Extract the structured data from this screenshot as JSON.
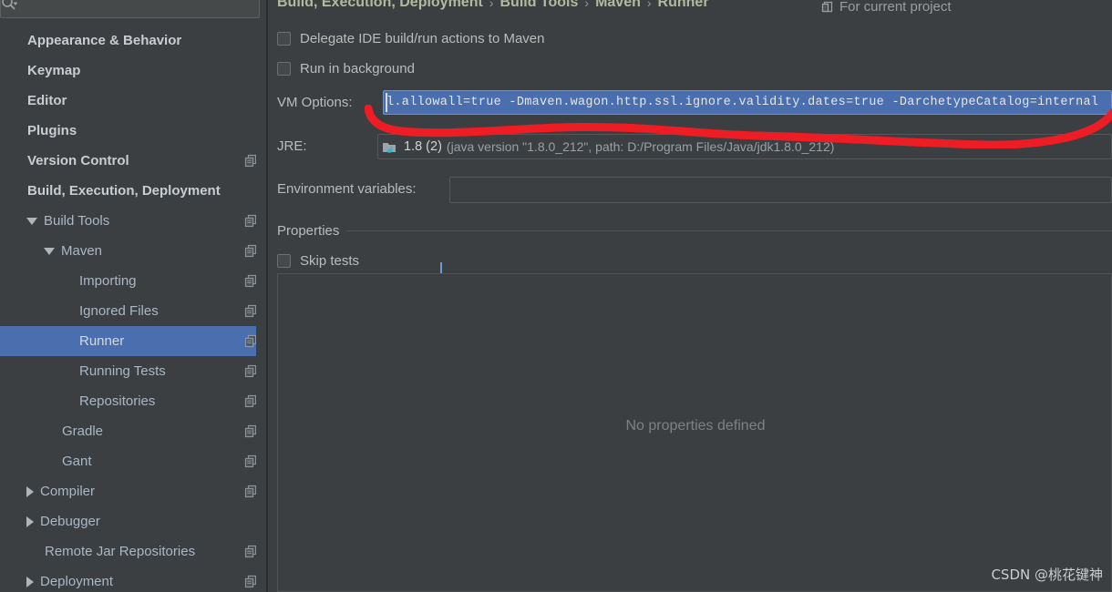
{
  "search": {
    "placeholder": "",
    "value": "",
    "icon": "search-icon"
  },
  "sidebar": {
    "items": [
      {
        "label": "Appearance & Behavior",
        "arrow": "none",
        "bold": true,
        "indent": 0,
        "copy": false,
        "selected": false
      },
      {
        "label": "Keymap",
        "arrow": "none",
        "bold": true,
        "indent": 0,
        "copy": false,
        "selected": false
      },
      {
        "label": "Editor",
        "arrow": "none",
        "bold": true,
        "indent": 0,
        "copy": false,
        "selected": false
      },
      {
        "label": "Plugins",
        "arrow": "none",
        "bold": true,
        "indent": 0,
        "copy": false,
        "selected": false
      },
      {
        "label": "Version Control",
        "arrow": "none",
        "bold": true,
        "indent": 0,
        "copy": true,
        "selected": false
      },
      {
        "label": "Build, Execution, Deployment",
        "arrow": "none",
        "bold": true,
        "indent": 0,
        "copy": false,
        "selected": false
      },
      {
        "label": "Build Tools",
        "arrow": "down",
        "bold": false,
        "indent": 1,
        "copy": true,
        "selected": false
      },
      {
        "label": "Maven",
        "arrow": "down",
        "bold": false,
        "indent": 2,
        "copy": true,
        "selected": false
      },
      {
        "label": "Importing",
        "arrow": "none",
        "bold": false,
        "indent": 3,
        "copy": true,
        "selected": false
      },
      {
        "label": "Ignored Files",
        "arrow": "none",
        "bold": false,
        "indent": 3,
        "copy": true,
        "selected": false
      },
      {
        "label": "Runner",
        "arrow": "none",
        "bold": false,
        "indent": 3,
        "copy": true,
        "selected": true
      },
      {
        "label": "Running Tests",
        "arrow": "none",
        "bold": false,
        "indent": 3,
        "copy": true,
        "selected": false
      },
      {
        "label": "Repositories",
        "arrow": "none",
        "bold": false,
        "indent": 3,
        "copy": true,
        "selected": false
      },
      {
        "label": "Gradle",
        "arrow": "none",
        "bold": false,
        "indent": 2,
        "copy": true,
        "selected": false
      },
      {
        "label": "Gant",
        "arrow": "none",
        "bold": false,
        "indent": 2,
        "copy": true,
        "selected": false
      },
      {
        "label": "Compiler",
        "arrow": "right",
        "bold": false,
        "indent": 1,
        "copy": true,
        "selected": false
      },
      {
        "label": "Debugger",
        "arrow": "right",
        "bold": false,
        "indent": 1,
        "copy": false,
        "selected": false
      },
      {
        "label": "Remote Jar Repositories",
        "arrow": "none",
        "bold": false,
        "indent": 1,
        "copy": true,
        "selected": false
      },
      {
        "label": "Deployment",
        "arrow": "right",
        "bold": false,
        "indent": 1,
        "copy": true,
        "selected": false
      }
    ]
  },
  "breadcrumb": {
    "crumbs": [
      "Build, Execution, Deployment",
      "Build Tools",
      "Maven",
      "Runner"
    ],
    "separator": "›"
  },
  "scope": {
    "label": "For current project",
    "icon": "project-scope-icon"
  },
  "main": {
    "delegate_checkbox": {
      "label": "Delegate IDE build/run actions to Maven",
      "checked": false
    },
    "background_checkbox": {
      "label": "Run in background",
      "checked": false
    },
    "vm_options": {
      "label": "VM Options:",
      "value": "l.allowall=true -Dmaven.wagon.http.ssl.ignore.validity.dates=true -DarchetypeCatalog=internal"
    },
    "jre": {
      "label": "JRE:",
      "value": "1.8 (2)",
      "detail": "(java version \"1.8.0_212\", path: D:/Program Files/Java/jdk1.8.0_212)",
      "icon": "jdk-folder-icon"
    },
    "environment_variables": {
      "label": "Environment variables:",
      "value": ""
    },
    "properties": {
      "group_title": "Properties",
      "skip_tests": {
        "label": "Skip tests",
        "checked": false
      },
      "empty_text": "No properties defined"
    }
  },
  "annotation": {
    "color": "#ee1c25",
    "type": "hand-drawn-underline"
  },
  "watermark": {
    "text": "CSDN @桃花键神"
  },
  "colors": {
    "background": "#3c3f41",
    "selection": "#4b6eaf",
    "text": "#bbbbbb",
    "breadcrumb": "#b2b99f",
    "annotation_red": "#ee1c25"
  }
}
